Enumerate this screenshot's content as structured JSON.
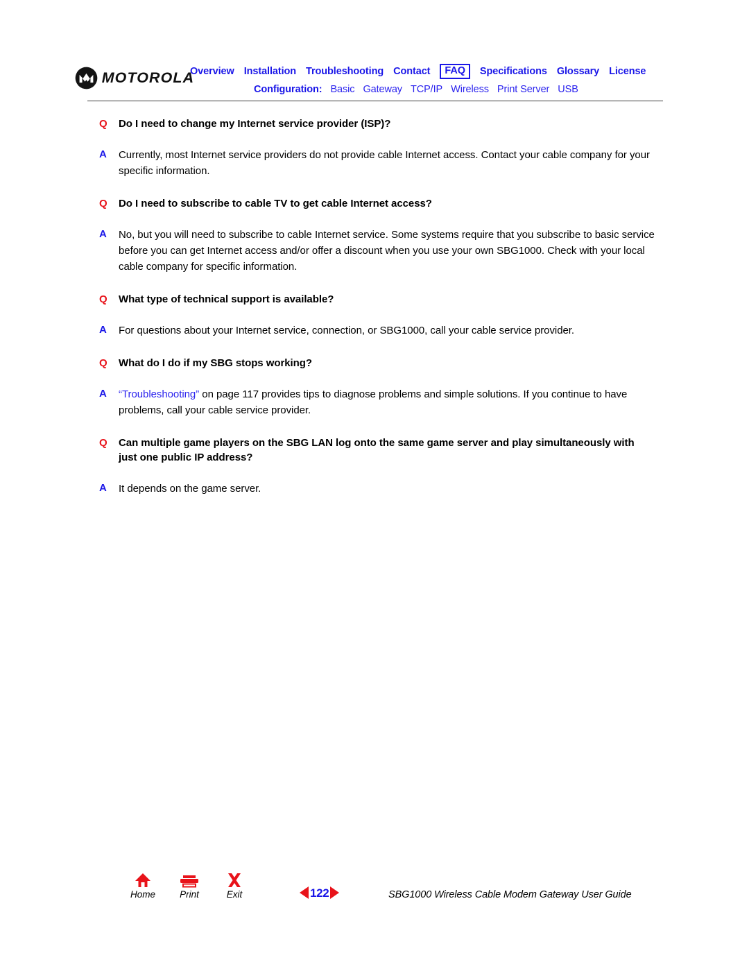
{
  "header": {
    "logo": {
      "icon": "motorola-batwing-icon",
      "wordmark": "MOTOROLA"
    },
    "nav_primary": [
      {
        "label": "Overview",
        "boxed": false
      },
      {
        "label": "Installation",
        "boxed": false
      },
      {
        "label": "Troubleshooting",
        "boxed": false
      },
      {
        "label": "Contact",
        "boxed": false
      },
      {
        "label": "FAQ",
        "boxed": true
      },
      {
        "label": "Specifications",
        "boxed": false
      },
      {
        "label": "Glossary",
        "boxed": false
      },
      {
        "label": "License",
        "boxed": false
      }
    ],
    "nav_secondary_label": "Configuration:",
    "nav_secondary": [
      {
        "label": "Basic"
      },
      {
        "label": "Gateway"
      },
      {
        "label": "TCP/IP"
      },
      {
        "label": "Wireless"
      },
      {
        "label": "Print Server"
      },
      {
        "label": "USB"
      }
    ]
  },
  "faq": {
    "q_marker": "Q",
    "a_marker": "A",
    "items": [
      {
        "question": "Do I need to change my Internet service provider (ISP)?",
        "answer_pre": "Currently, most Internet service providers do not provide cable Internet access. Contact your cable company for your specific information.",
        "answer_link": "",
        "answer_post": ""
      },
      {
        "question": "Do I need to subscribe to cable TV to get cable Internet access?",
        "answer_pre": "No, but you will need to subscribe to cable Internet service. Some systems require that you subscribe to basic service before you can get Internet access and/or offer a discount when you use your own SBG1000. Check with your local cable company for specific information.",
        "answer_link": "",
        "answer_post": ""
      },
      {
        "question": "What type of technical support is available?",
        "answer_pre": "For questions about your Internet service, connection, or SBG1000, call your cable service provider.",
        "answer_link": "",
        "answer_post": ""
      },
      {
        "question": "What do I do if my SBG stops working?",
        "answer_pre": "",
        "answer_link": "“Troubleshooting”",
        "answer_post": " on page 117 provides tips to diagnose problems and simple solutions. If you continue to have problems, call your cable service provider."
      },
      {
        "question": "Can multiple game players on the SBG LAN log onto the same game server and play simultaneously with just one public IP address?",
        "answer_pre": "It depends on the game server.",
        "answer_link": "",
        "answer_post": ""
      }
    ]
  },
  "footer": {
    "buttons": [
      {
        "icon": "home-icon",
        "label": "Home"
      },
      {
        "icon": "printer-icon",
        "label": "Print"
      },
      {
        "icon": "exit-x-icon",
        "label": "Exit"
      }
    ],
    "pager": {
      "prev_icon": "triangle-left-icon",
      "page_number": "122",
      "next_icon": "triangle-right-icon"
    },
    "document_title": "SBG1000 Wireless Cable Modem Gateway User Guide"
  },
  "colors": {
    "link_blue": "#1a16e8",
    "sub_link_blue": "#2b23ee",
    "q_red": "#e8131a",
    "rule_gray": "#b6b6b6",
    "text_black": "#000000"
  }
}
